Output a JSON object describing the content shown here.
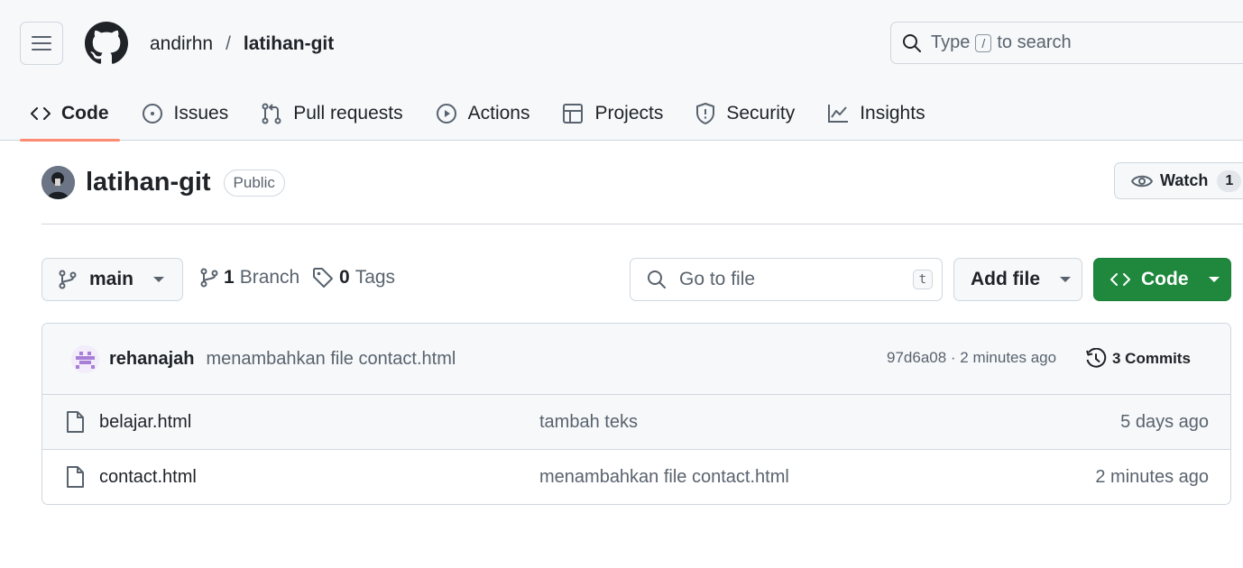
{
  "header": {
    "owner": "andirhn",
    "separator": "/",
    "repo": "latihan-git",
    "search": {
      "prefix": "Type",
      "key": "/",
      "suffix": "to search"
    }
  },
  "tabs": [
    {
      "label": "Code",
      "icon": "code-icon",
      "active": true
    },
    {
      "label": "Issues",
      "icon": "issue-icon"
    },
    {
      "label": "Pull requests",
      "icon": "pull-request-icon"
    },
    {
      "label": "Actions",
      "icon": "play-icon"
    },
    {
      "label": "Projects",
      "icon": "table-icon"
    },
    {
      "label": "Security",
      "icon": "shield-icon"
    },
    {
      "label": "Insights",
      "icon": "graph-icon"
    }
  ],
  "repo_head": {
    "name": "latihan-git",
    "visibility": "Public",
    "watch_label": "Watch",
    "watch_count": "1"
  },
  "toolbar": {
    "branch": "main",
    "branches_count": "1",
    "branches_label": "Branch",
    "tags_count": "0",
    "tags_label": "Tags",
    "goto_placeholder": "Go to file",
    "goto_shortcut": "t",
    "add_file": "Add file",
    "code": "Code"
  },
  "latest_commit": {
    "author": "rehanajah",
    "message": "menambahkan file contact.html",
    "hash_time": "97d6a08 · 2 minutes ago",
    "commits": "3 Commits"
  },
  "files": [
    {
      "name": "belajar.html",
      "message": "tambah teks",
      "age": "5 days ago"
    },
    {
      "name": "contact.html",
      "message": "menambahkan file contact.html",
      "age": "2 minutes ago"
    }
  ],
  "colors": {
    "primary_button": "#1f883d",
    "active_tab_underline": "#fd8c73",
    "muted_text": "#59636e",
    "header_bg": "#f6f8fa"
  }
}
